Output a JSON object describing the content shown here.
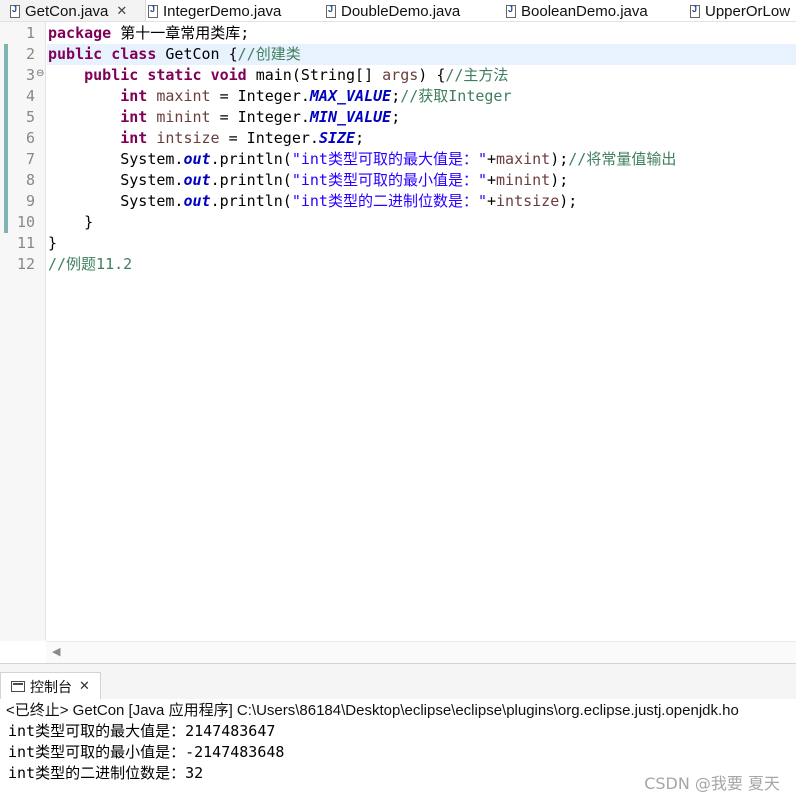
{
  "tabs": [
    {
      "label": "GetCon.java",
      "active": true,
      "closable": true
    },
    {
      "label": "IntegerDemo.java",
      "active": false
    },
    {
      "label": "DoubleDemo.java",
      "active": false
    },
    {
      "label": "BooleanDemo.java",
      "active": false
    },
    {
      "label": "UpperOrLow",
      "active": false
    }
  ],
  "editor": {
    "line_numbers": [
      "1",
      "2",
      "3",
      "4",
      "5",
      "6",
      "7",
      "8",
      "9",
      "10",
      "11",
      "12"
    ],
    "lines": [
      [
        {
          "t": "package",
          "c": "kw"
        },
        {
          "t": " 第十一章常用类库;",
          "c": "pl"
        }
      ],
      [
        {
          "t": "public",
          "c": "kw"
        },
        {
          "t": " ",
          "c": "pl"
        },
        {
          "t": "class",
          "c": "kw"
        },
        {
          "t": " GetCon {",
          "c": "pl"
        },
        {
          "t": "//创建类",
          "c": "cm"
        }
      ],
      [
        {
          "t": "    ",
          "c": "pl"
        },
        {
          "t": "public",
          "c": "kw"
        },
        {
          "t": " ",
          "c": "pl"
        },
        {
          "t": "static",
          "c": "kw"
        },
        {
          "t": " ",
          "c": "pl"
        },
        {
          "t": "void",
          "c": "kw"
        },
        {
          "t": " main(String[] ",
          "c": "pl"
        },
        {
          "t": "args",
          "c": "vr"
        },
        {
          "t": ") {",
          "c": "pl"
        },
        {
          "t": "//主方法",
          "c": "cm"
        }
      ],
      [
        {
          "t": "        ",
          "c": "pl"
        },
        {
          "t": "int",
          "c": "kw"
        },
        {
          "t": " ",
          "c": "pl"
        },
        {
          "t": "maxint",
          "c": "vr"
        },
        {
          "t": " = Integer.",
          "c": "pl"
        },
        {
          "t": "MAX_VALUE",
          "c": "fd"
        },
        {
          "t": ";",
          "c": "pl"
        },
        {
          "t": "//获取Integer",
          "c": "cm"
        }
      ],
      [
        {
          "t": "        ",
          "c": "pl"
        },
        {
          "t": "int",
          "c": "kw"
        },
        {
          "t": " ",
          "c": "pl"
        },
        {
          "t": "minint",
          "c": "vr"
        },
        {
          "t": " = Integer.",
          "c": "pl"
        },
        {
          "t": "MIN_VALUE",
          "c": "fd"
        },
        {
          "t": ";",
          "c": "pl"
        }
      ],
      [
        {
          "t": "        ",
          "c": "pl"
        },
        {
          "t": "int",
          "c": "kw"
        },
        {
          "t": " ",
          "c": "pl"
        },
        {
          "t": "intsize",
          "c": "vr"
        },
        {
          "t": " = Integer.",
          "c": "pl"
        },
        {
          "t": "SIZE",
          "c": "fd"
        },
        {
          "t": ";",
          "c": "pl"
        }
      ],
      [
        {
          "t": "        System.",
          "c": "pl"
        },
        {
          "t": "out",
          "c": "fd"
        },
        {
          "t": ".println(",
          "c": "pl"
        },
        {
          "t": "\"int类型可取的最大值是：\"",
          "c": "st"
        },
        {
          "t": "+",
          "c": "pl"
        },
        {
          "t": "maxint",
          "c": "vr"
        },
        {
          "t": ");",
          "c": "pl"
        },
        {
          "t": "//将常量值输出",
          "c": "cm"
        }
      ],
      [
        {
          "t": "        System.",
          "c": "pl"
        },
        {
          "t": "out",
          "c": "fd"
        },
        {
          "t": ".println(",
          "c": "pl"
        },
        {
          "t": "\"int类型可取的最小值是：\"",
          "c": "st"
        },
        {
          "t": "+",
          "c": "pl"
        },
        {
          "t": "minint",
          "c": "vr"
        },
        {
          "t": ");",
          "c": "pl"
        }
      ],
      [
        {
          "t": "        System.",
          "c": "pl"
        },
        {
          "t": "out",
          "c": "fd"
        },
        {
          "t": ".println(",
          "c": "pl"
        },
        {
          "t": "\"int类型的二进制位数是：\"",
          "c": "st"
        },
        {
          "t": "+",
          "c": "pl"
        },
        {
          "t": "intsize",
          "c": "vr"
        },
        {
          "t": ");",
          "c": "pl"
        }
      ],
      [
        {
          "t": "    }",
          "c": "pl"
        }
      ],
      [
        {
          "t": "}",
          "c": "pl"
        }
      ],
      [
        {
          "t": "//例题11.2",
          "c": "cm"
        }
      ]
    ]
  },
  "colors": {
    "keyword": "#7f0055",
    "comment": "#3f7f5f",
    "string": "#2a00ff",
    "field": "#0000c0",
    "current_line": "#e8f2fe",
    "change_marker": "#7fb4b0"
  },
  "console": {
    "tab_label": "控制台",
    "header": "<已终止> GetCon [Java 应用程序] C:\\Users\\86184\\Desktop\\eclipse\\eclipse\\plugins\\org.eclipse.justj.openjdk.ho",
    "output": [
      "int类型可取的最大值是：2147483647",
      "int类型可取的最小值是：-2147483648",
      "int类型的二进制位数是：32"
    ]
  },
  "watermark": "CSDN @我要 夏天"
}
